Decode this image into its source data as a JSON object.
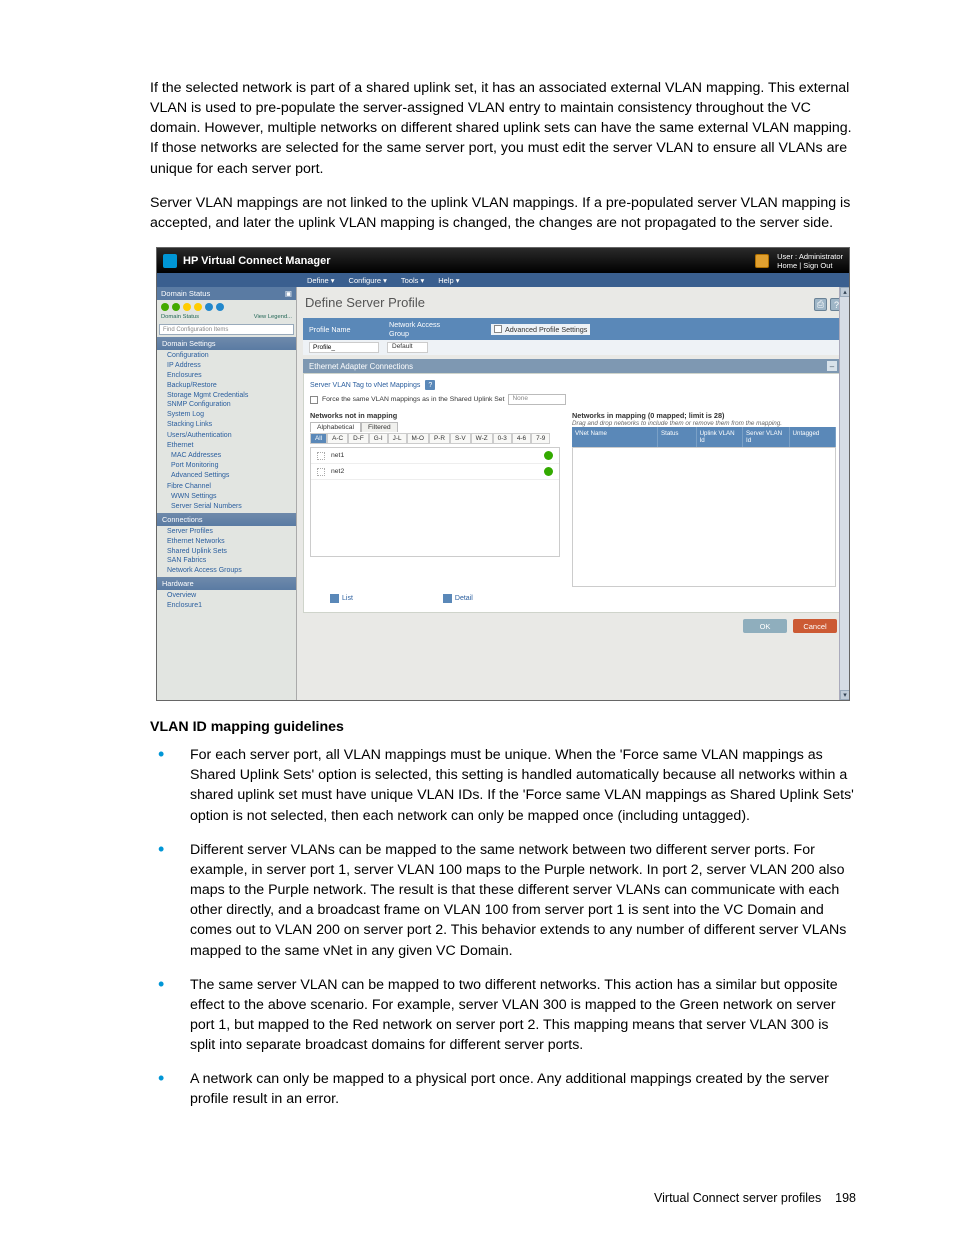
{
  "intro": {
    "p1": "If the selected network is part of a shared uplink set, it has an associated external VLAN mapping. This external VLAN is used to pre-populate the server-assigned VLAN entry to maintain consistency throughout the VC domain. However, multiple networks on different shared uplink sets can have the same external VLAN mapping. If those networks are selected for the same server port, you must edit the server VLAN to ensure all VLANs are unique for each server port.",
    "p2": "Server VLAN mappings are not linked to the uplink VLAN mappings. If a pre-populated server VLAN mapping is accepted, and later the uplink VLAN mapping is changed, the changes are not propagated to the server side."
  },
  "shot": {
    "title": "HP Virtual Connect Manager",
    "user": "User : Administrator",
    "home": "Home",
    "signout": "Sign Out",
    "menus": {
      "define": "Define ▾",
      "configure": "Configure ▾",
      "tools": "Tools ▾",
      "help": "Help ▾"
    },
    "sidebar": {
      "domain_status": "Domain Status",
      "domain_lbl": "Domain Status",
      "legend": "View Legend...",
      "find_placeholder": "Find Configuration Items",
      "domain_settings": "Domain Settings",
      "items1": [
        "Configuration",
        "IP Address",
        "Enclosures",
        "Backup/Restore",
        "Storage Mgmt Credentials",
        "SNMP Configuration",
        "System Log",
        "Stacking Links"
      ],
      "users": "Users/Authentication",
      "eth": "Ethernet",
      "eth_items": [
        "MAC Addresses",
        "Port Monitoring",
        "Advanced Settings"
      ],
      "fc": "Fibre Channel",
      "fc_items": [
        "WWN Settings",
        "Server Serial Numbers"
      ],
      "connections": "Connections",
      "conn_items": [
        "Server Profiles",
        "Ethernet Networks",
        "Shared Uplink Sets",
        "SAN Fabrics",
        "Network Access Groups"
      ],
      "hardware": "Hardware",
      "hw_items": [
        "Overview",
        "Enclosure1"
      ]
    },
    "main": {
      "title": "Define Server Profile",
      "profile_bar": {
        "name_lbl": "Profile Name",
        "nag_lbl": "Network Access Group",
        "name_val": "Profile_",
        "nag_val": "Default",
        "adv": "Advanced Profile Settings"
      },
      "eac_hdr": "Ethernet Adapter Connections",
      "svt_label": "Server VLAN Tag to vNet Mappings",
      "force_label": "Force the same VLAN mappings as in the Shared Uplink Set",
      "force_dd": "None",
      "left": {
        "title": "Networks not in mapping",
        "tab_alpha": "Alphabetical",
        "tab_filter": "Filtered",
        "alpha_tabs": [
          "All",
          "A-C",
          "D-F",
          "G-I",
          "J-L",
          "M-O",
          "P-R",
          "S-V",
          "W-Z",
          "0-3",
          "4-6",
          "7-9"
        ],
        "rows": [
          "net1",
          "net2"
        ]
      },
      "right": {
        "title": "Networks in mapping (0 mapped; limit is 28)",
        "sub": "Drag and drop networks to include them or remove them from the mapping.",
        "cols": [
          "VNet Name",
          "Status",
          "Uplink VLAN Id",
          "Server VLAN Id",
          "Untagged"
        ]
      },
      "view_list": "List",
      "view_detail": "Detail",
      "btn_ok": "OK",
      "btn_cancel": "Cancel"
    }
  },
  "guidelines": {
    "heading": "VLAN ID mapping guidelines",
    "b1": "For each server port, all VLAN mappings must be unique. When the 'Force same VLAN mappings as Shared Uplink Sets' option is selected, this setting is handled automatically because all networks within a shared uplink set must have unique VLAN IDs. If the 'Force same VLAN mappings as Shared Uplink Sets' option is not selected, then each network can only be mapped once (including untagged).",
    "b2": "Different server VLANs can be mapped to the same network between two different server ports. For example, in server port 1, server VLAN 100 maps to the Purple network. In port 2, server VLAN 200 also maps to the Purple network. The result is that these different server VLANs can communicate with each other directly, and a broadcast frame on VLAN 100 from server port 1 is sent into the VC Domain and comes out to VLAN 200 on server port 2. This behavior extends to any number of different server VLANs mapped to the same vNet in any given VC Domain.",
    "b3": "The same server VLAN can be mapped to two different networks. This action has a similar but opposite effect to the above scenario. For example, server VLAN 300 is mapped to the Green network on server port 1, but mapped to the Red network on server port 2. This mapping means that server VLAN 300 is split into separate broadcast domains for different server ports.",
    "b4": "A network can only be mapped to a physical port once. Any additional mappings created by the server profile result in an error."
  },
  "footer": {
    "section": "Virtual Connect server profiles",
    "page": "198"
  }
}
